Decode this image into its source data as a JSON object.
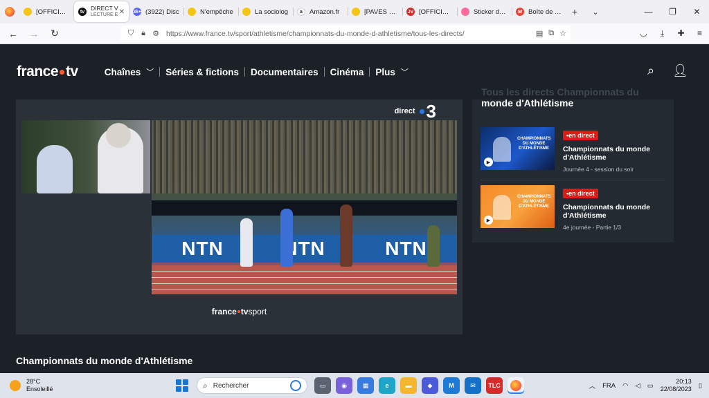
{
  "browser": {
    "tabs": [
      {
        "label": "[OFFICIEL] C",
        "color": "#f5c518",
        "glyph": ""
      },
      {
        "label": "DIRECT V",
        "sub": "LECTURE E",
        "color": "#111111",
        "glyph": "tv",
        "active": true
      },
      {
        "label": "(3922) Disc",
        "color": "#5865f2",
        "glyph": "3k+"
      },
      {
        "label": "N'empêche",
        "color": "#f5c518",
        "glyph": ""
      },
      {
        "label": "La sociolog",
        "color": "#f5c518",
        "glyph": ""
      },
      {
        "label": "Amazon.fr",
        "color": "#ffffff",
        "glyph": "a"
      },
      {
        "label": "[PAVES HIST",
        "color": "#f5c518",
        "glyph": ""
      },
      {
        "label": "[OFFICIEL] C",
        "color": "#d42b2b",
        "glyph": "JV"
      },
      {
        "label": "Sticker de L",
        "color": "#ff6b9a",
        "glyph": ""
      },
      {
        "label": "Boîte de réc",
        "color": "#ea4335",
        "glyph": "M"
      }
    ],
    "new_tab": "+",
    "tab_list": "⌄",
    "url": "https://www.france.tv/sport/athletisme/championnats-du-monde-d-athletisme/tous-les-directs/"
  },
  "site": {
    "logo_left": "france",
    "logo_right": "tv",
    "nav": [
      {
        "label": "Chaînes",
        "chevron": true
      },
      {
        "label": "Séries & fictions",
        "chevron": false
      },
      {
        "label": "Documentaires",
        "chevron": false
      },
      {
        "label": "Cinéma",
        "chevron": false
      },
      {
        "label": "Plus",
        "chevron": true
      }
    ],
    "player": {
      "channel_label": "direct",
      "channel_num": "3",
      "brand_left": "france",
      "brand_mid": "tv",
      "brand_right": "sport",
      "video_ad": "NTN"
    },
    "side": {
      "title_ghost": "Tous les directs Championnats du",
      "title": "monde d'Athlétisme",
      "cards": [
        {
          "badge": "•en direct",
          "title": "Championnats du monde d'Athlétisme",
          "subtitle": "Journée 4 - session du soir",
          "thumb_text": "CHAMPIONNATS DU MONDE D'ATHLÉTISME"
        },
        {
          "badge": "•en direct",
          "title": "Championnats du monde d'Athlétisme",
          "subtitle": "4e journée - Partie 1/3",
          "thumb_text": "CHAMPIONNATS DU MONDE D'ATHLÉTISME"
        }
      ]
    },
    "section_title": "Championnats du monde d'Athlétisme"
  },
  "taskbar": {
    "temp": "28°C",
    "weather": "Ensoleillé",
    "search_placeholder": "Rechercher",
    "lang": "FRA",
    "time": "20:13",
    "date": "22/08/2023"
  }
}
